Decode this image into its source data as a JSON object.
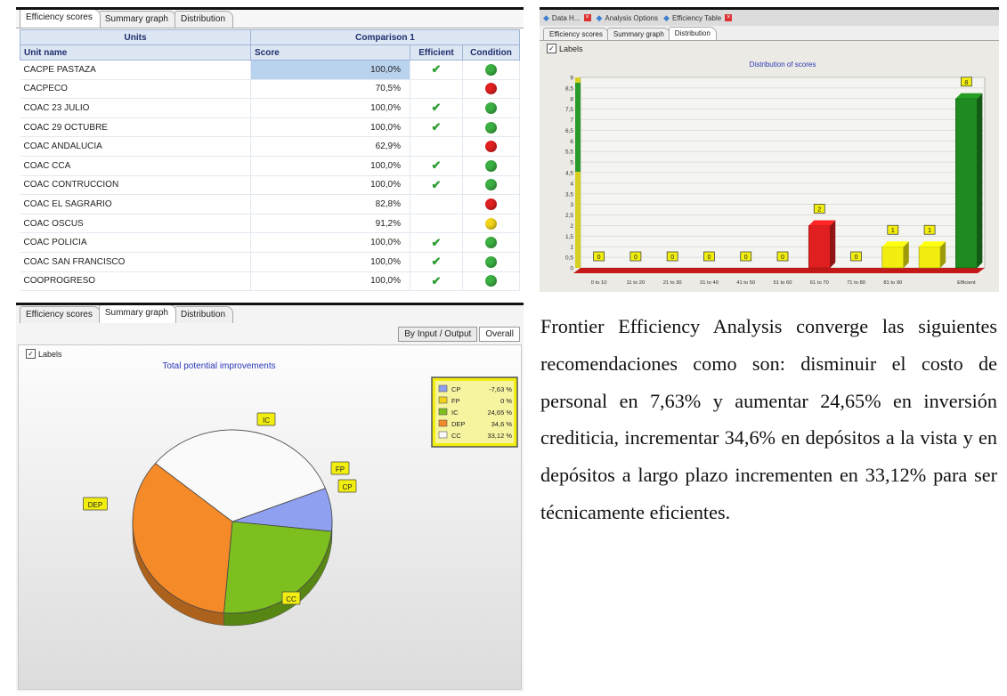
{
  "table_panel": {
    "tabs": [
      "Efficiency scores",
      "Summary graph",
      "Distribution"
    ],
    "header_group_units": "Units",
    "header_group_comparison": "Comparison 1",
    "columns": [
      "Unit name",
      "Score",
      "Efficient",
      "Condition"
    ],
    "rows": [
      {
        "name": "CACPE PASTAZA",
        "score": "100,0%",
        "efficient": true,
        "condition": "green"
      },
      {
        "name": "CACPECO",
        "score": "70,5%",
        "efficient": false,
        "condition": "red"
      },
      {
        "name": "COAC 23 JULIO",
        "score": "100,0%",
        "efficient": true,
        "condition": "green"
      },
      {
        "name": "COAC 29 OCTUBRE",
        "score": "100,0%",
        "efficient": true,
        "condition": "green"
      },
      {
        "name": "COAC ANDALUCIA",
        "score": "62,9%",
        "efficient": false,
        "condition": "red"
      },
      {
        "name": "COAC CCA",
        "score": "100,0%",
        "efficient": true,
        "condition": "green"
      },
      {
        "name": "COAC CONTRUCCION",
        "score": "100,0%",
        "efficient": true,
        "condition": "green"
      },
      {
        "name": "COAC EL SAGRARIO",
        "score": "82,8%",
        "efficient": false,
        "condition": "red"
      },
      {
        "name": "COAC OSCUS",
        "score": "91,2%",
        "efficient": false,
        "condition": "yellow"
      },
      {
        "name": "COAC POLICIA",
        "score": "100,0%",
        "efficient": true,
        "condition": "green"
      },
      {
        "name": "COAC SAN FRANCISCO",
        "score": "100,0%",
        "efficient": true,
        "condition": "green"
      },
      {
        "name": "COOPROGRESO",
        "score": "100,0%",
        "efficient": true,
        "condition": "green"
      }
    ],
    "check_glyph": "✔",
    "condition_colors": {
      "green": "#3cb043",
      "red": "#e02020",
      "yellow": "#f2d41a"
    }
  },
  "distribution_panel": {
    "doc_tabs": [
      "Data H...",
      "Analysis Options",
      "Efficiency Table"
    ],
    "tabs": [
      "Efficiency scores",
      "Summary graph",
      "Distribution"
    ],
    "labels_checkbox": "Labels",
    "chart_data": {
      "type": "bar",
      "title": "Distribution of scores",
      "categories": [
        "0 to 10",
        "11 to 20",
        "21 to 30",
        "31 to 40",
        "41 to 50",
        "51 to 60",
        "61 to 70",
        "71 to 80",
        "81 to 90",
        "",
        "Efficient"
      ],
      "values": [
        0,
        0,
        0,
        0,
        0,
        0,
        2,
        0,
        1,
        1,
        8
      ],
      "bar_colors": [
        "#e02020",
        "#e02020",
        "#e02020",
        "#e02020",
        "#e02020",
        "#e02020",
        "#e02020",
        "#e02020",
        "#f2ee10",
        "#f2ee10",
        "#1f8a1f"
      ],
      "y_ticks": [
        "0",
        "0,5",
        "1",
        "1,5",
        "2",
        "2,5",
        "3",
        "3,5",
        "4",
        "4,5",
        "5",
        "5,5",
        "6",
        "6,5",
        "7",
        "7,5",
        "8",
        "8,5",
        "9"
      ],
      "ylim": [
        0,
        9
      ],
      "grid": true
    }
  },
  "summary_panel": {
    "tabs": [
      "Efficiency scores",
      "Summary graph",
      "Distribution"
    ],
    "sub_tabs": [
      "By Input / Output",
      "Overall"
    ],
    "labels_checkbox": "Labels",
    "chart_data": {
      "type": "pie",
      "title": "Total potential improvements",
      "slices": [
        {
          "label": "CP",
          "legend_value": "-7,63 %",
          "value": 7.63,
          "color": "#8fa0f0"
        },
        {
          "label": "FP",
          "legend_value": "0 %",
          "value": 0,
          "color": "#f2d41a"
        },
        {
          "label": "IC",
          "legend_value": "24,65 %",
          "value": 24.65,
          "color": "#7cbf1e"
        },
        {
          "label": "DEP",
          "legend_value": "34,6 %",
          "value": 34.6,
          "color": "#f58a28"
        },
        {
          "label": "CC",
          "legend_value": "33,12 %",
          "value": 33.12,
          "color": "#fafafa"
        }
      ],
      "legend_placement": "top-right"
    }
  },
  "paragraph": "Frontier Efficiency Analysis converge las siguientes recomendaciones como son: disminuir el costo de personal en 7,63% y aumentar 24,65% en inversión crediticia, incrementar 34,6% en depósitos a la vista y en depósitos a largo plazo incrementen en 33,12% para ser técnicamente eficientes."
}
